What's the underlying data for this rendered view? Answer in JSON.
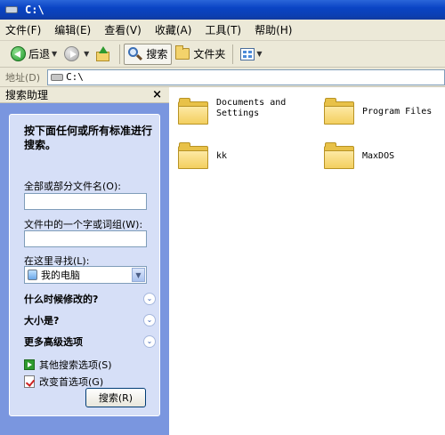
{
  "window": {
    "title": "C:\\"
  },
  "menu": [
    "文件(F)",
    "编辑(E)",
    "查看(V)",
    "收藏(A)",
    "工具(T)",
    "帮助(H)"
  ],
  "toolbar": {
    "back": "后退",
    "search": "搜索",
    "folders": "文件夹"
  },
  "address": {
    "label": "地址(D)",
    "value": "C:\\"
  },
  "search_pane": {
    "title": "搜索助理",
    "close": "×",
    "prompt": "按下面任何或所有标准进行搜索。",
    "filename_label": "全部或部分文件名(O):",
    "filename_value": "",
    "phrase_label": "文件中的一个字或词组(W):",
    "phrase_value": "",
    "lookin_label": "在这里寻找(L):",
    "lookin_value": "我的电脑",
    "options": [
      {
        "label": "什么时候修改的?"
      },
      {
        "label": "大小是?"
      },
      {
        "label": "更多高级选项"
      }
    ],
    "links": [
      {
        "label": "其他搜索选项(S)"
      },
      {
        "label": "改变首选项(G)"
      }
    ],
    "search_button": "搜索(R)"
  },
  "folders": [
    {
      "name": "Documents and\nSettings"
    },
    {
      "name": "Program Files"
    },
    {
      "name": "kk"
    },
    {
      "name": "MaxDOS"
    }
  ],
  "colors": {
    "title_bar": "#0a44c4",
    "pane_bg": "#7a96df",
    "pane_box": "#d6dff7",
    "folder": "#f3cf5f"
  }
}
